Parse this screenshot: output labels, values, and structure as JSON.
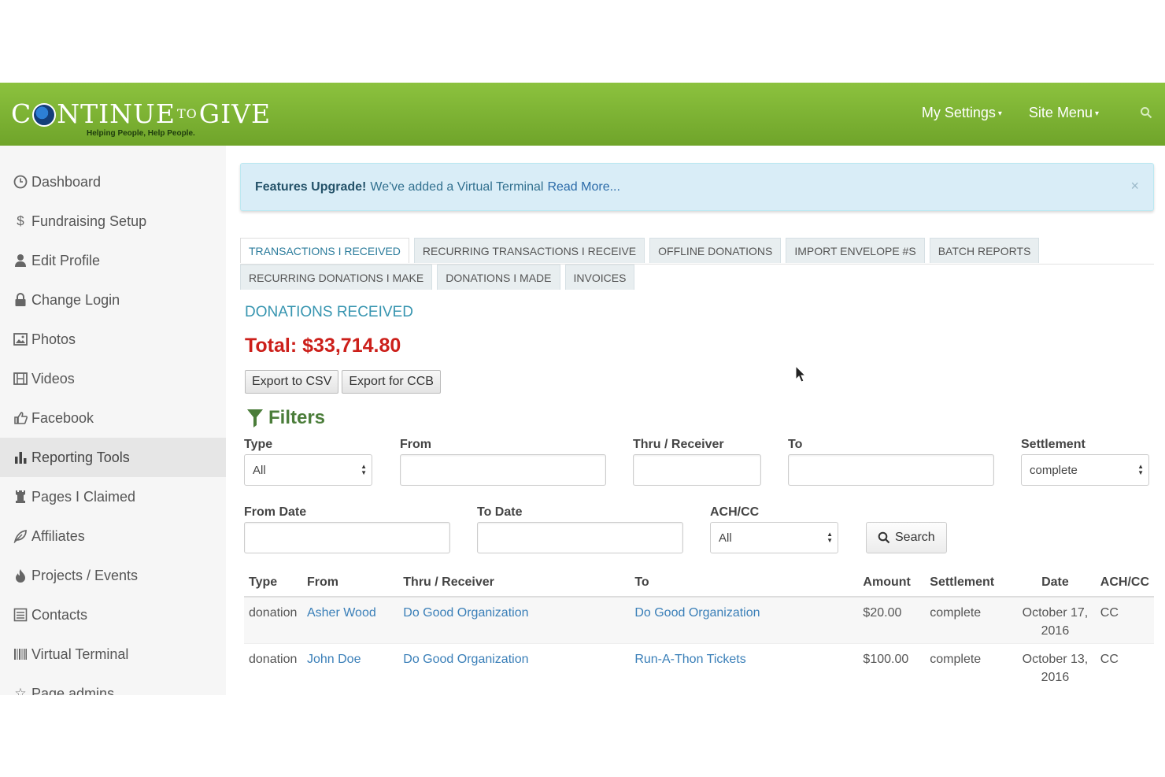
{
  "header": {
    "logo_text_1": "C",
    "logo_text_2": "NTINUE",
    "logo_to": "TO",
    "logo_text_3": "GIVE",
    "tagline": "Helping People, Help People.",
    "menu": [
      {
        "label": "My Settings"
      },
      {
        "label": "Site Menu"
      }
    ]
  },
  "sidebar": {
    "items": [
      {
        "label": "Dashboard",
        "icon": "clock-icon"
      },
      {
        "label": "Fundraising Setup",
        "icon": "dollar-icon"
      },
      {
        "label": "Edit Profile",
        "icon": "user-icon"
      },
      {
        "label": "Change Login",
        "icon": "lock-icon"
      },
      {
        "label": "Photos",
        "icon": "picture-icon"
      },
      {
        "label": "Videos",
        "icon": "film-icon"
      },
      {
        "label": "Facebook",
        "icon": "thumbs-up-icon"
      },
      {
        "label": "Reporting Tools",
        "icon": "bar-chart-icon"
      },
      {
        "label": "Pages I Claimed",
        "icon": "tower-icon"
      },
      {
        "label": "Affiliates",
        "icon": "leaf-icon"
      },
      {
        "label": "Projects / Events",
        "icon": "fire-icon"
      },
      {
        "label": "Contacts",
        "icon": "list-icon"
      },
      {
        "label": "Virtual Terminal",
        "icon": "barcode-icon"
      },
      {
        "label": "Page admins",
        "icon": "star-icon"
      }
    ],
    "active_index": 7
  },
  "alert": {
    "strong": "Features Upgrade!",
    "text": "We've added a Virtual Terminal",
    "link": "Read More...",
    "close": "×"
  },
  "tabs": {
    "row1": [
      "TRANSACTIONS I RECEIVED",
      "RECURRING TRANSACTIONS I RECEIVE",
      "OFFLINE DONATIONS",
      "IMPORT ENVELOPE #S",
      "BATCH REPORTS"
    ],
    "row2": [
      "RECURRING DONATIONS I MAKE",
      "DONATIONS I MADE",
      "INVOICES"
    ],
    "active": "TRANSACTIONS I RECEIVED"
  },
  "section_title": "DONATIONS RECEIVED",
  "total": "Total: $33,714.80",
  "buttons": {
    "export_csv": "Export to CSV",
    "export_ccb": "Export for CCB"
  },
  "filters": {
    "title": "Filters",
    "type_label": "Type",
    "type_value": "All",
    "from_label": "From",
    "from_value": "",
    "thru_label": "Thru / Receiver",
    "thru_value": "",
    "to_label": "To",
    "to_value": "",
    "settlement_label": "Settlement",
    "settlement_value": "complete",
    "from_date_label": "From Date",
    "from_date_value": "",
    "to_date_label": "To Date",
    "to_date_value": "",
    "achcc_label": "ACH/CC",
    "achcc_value": "All",
    "search_label": "Search"
  },
  "table": {
    "columns": [
      "Type",
      "From",
      "Thru / Receiver",
      "To",
      "Amount",
      "Settlement",
      "Date",
      "ACH/CC"
    ],
    "rows": [
      {
        "type": "donation",
        "from": "Asher Wood",
        "thru": "Do Good Organization",
        "to": "Do Good Organization",
        "amount": "$20.00",
        "settlement": "complete",
        "date_1": "October 17,",
        "date_2": "2016",
        "achcc": "CC"
      },
      {
        "type": "donation",
        "from": "John Doe",
        "thru": "Do Good Organization",
        "to": "Run-A-Thon Tickets",
        "amount": "$100.00",
        "settlement": "complete",
        "date_1": "October 13,",
        "date_2": "2016",
        "achcc": "CC"
      }
    ]
  },
  "colors": {
    "header_green": "#7ab232",
    "total_red": "#cc1f1a",
    "title_blue": "#3795b0",
    "filters_green": "#4b7d3a",
    "link_blue": "#3a7fb8"
  }
}
